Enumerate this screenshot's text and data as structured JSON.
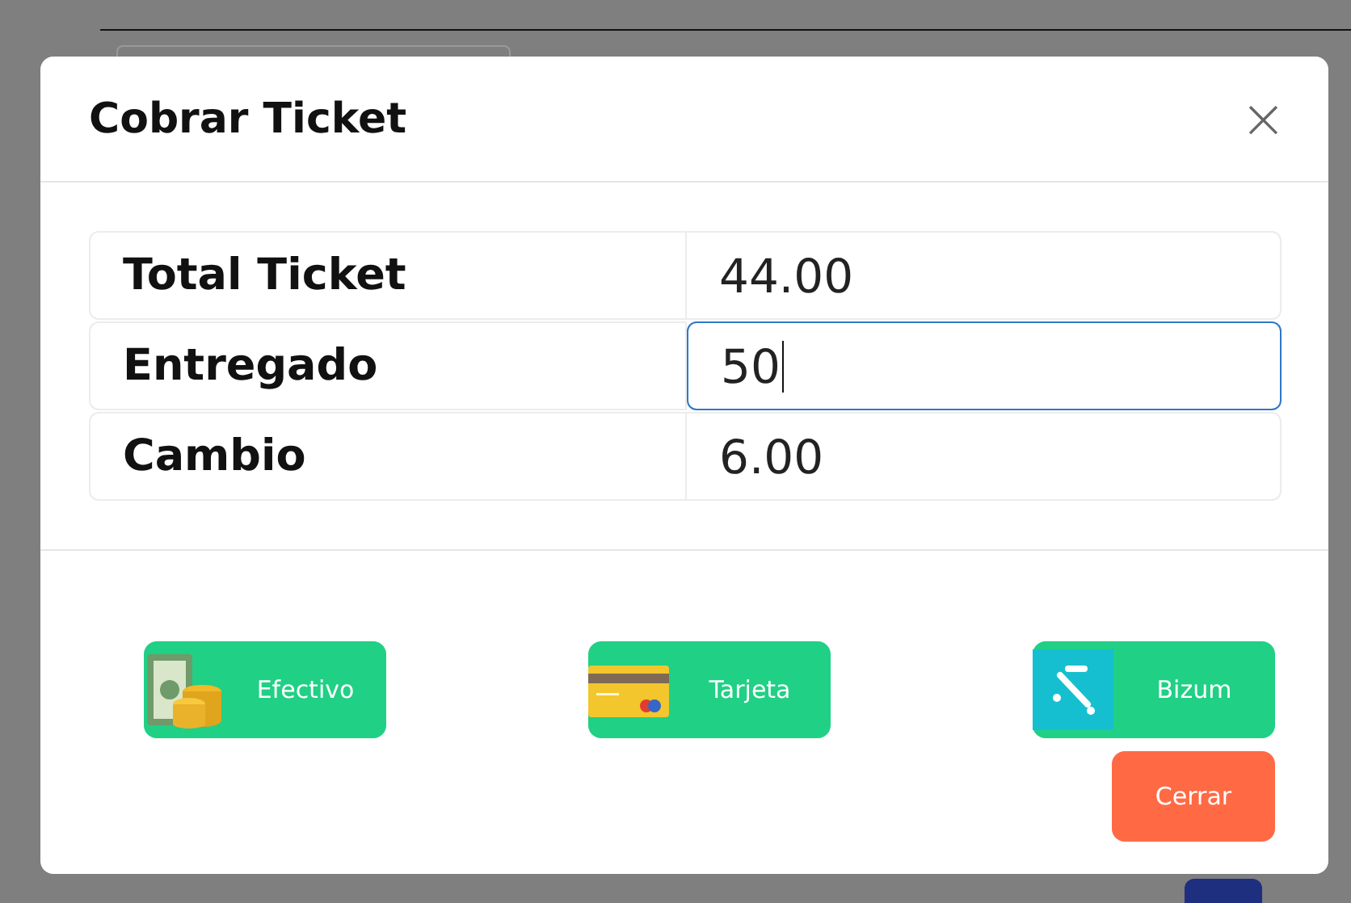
{
  "dialog": {
    "title": "Cobrar Ticket",
    "close": "×",
    "rows": [
      {
        "label": "Total Ticket",
        "kind": "text",
        "value": "44.00"
      },
      {
        "label": "Entregado",
        "kind": "input",
        "value": "50",
        "focused": true
      },
      {
        "label": "Cambio",
        "kind": "text",
        "value": "6.00"
      }
    ],
    "payment_buttons": [
      {
        "label": "Efectivo",
        "kind": "cash"
      },
      {
        "label": "Tarjeta",
        "kind": "card"
      },
      {
        "label": "Bizum",
        "kind": "bizum"
      }
    ],
    "close_button": "Cerrar"
  }
}
